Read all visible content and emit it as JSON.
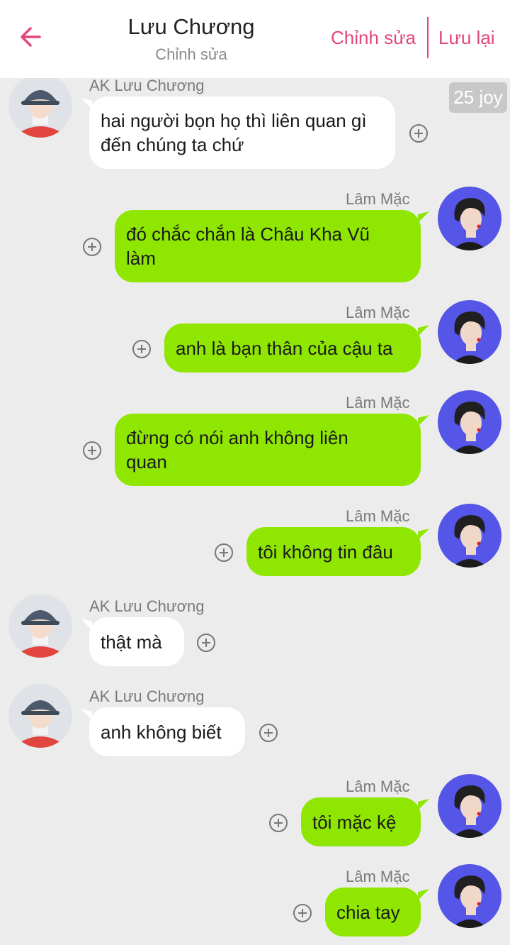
{
  "header": {
    "title": "Lưu Chương",
    "subtitle": "Chỉnh sửa",
    "edit_label": "Chỉnh sửa",
    "save_label": "Lưu lại"
  },
  "badge": "25 joy",
  "colors": {
    "accent": "#e2467f",
    "bubble_out": "#8fe600",
    "bubble_in": "#ffffff",
    "background": "#ececec"
  },
  "icons": {
    "back": "arrow-left-icon",
    "add": "plus-circle-icon"
  },
  "messages": [
    {
      "sender": "AK Lưu Chương",
      "direction": "in",
      "lines": [
        "hai người bọn họ thì liên quan gì",
        "đến chúng ta chứ"
      ]
    },
    {
      "sender": "Lâm Mặc",
      "direction": "out",
      "lines": [
        "đó chắc chắn là Châu Kha Vũ",
        "làm"
      ]
    },
    {
      "sender": "Lâm Mặc",
      "direction": "out",
      "lines": [
        "anh là bạn thân của cậu ta"
      ]
    },
    {
      "sender": "Lâm Mặc",
      "direction": "out",
      "lines": [
        "đừng có nói anh không liên",
        "quan"
      ]
    },
    {
      "sender": "Lâm Mặc",
      "direction": "out",
      "lines": [
        "tôi không tin đâu"
      ]
    },
    {
      "sender": "AK Lưu Chương",
      "direction": "in",
      "lines": [
        "thật mà"
      ]
    },
    {
      "sender": "AK Lưu Chương",
      "direction": "in",
      "lines": [
        "anh không biết"
      ]
    },
    {
      "sender": "Lâm Mặc",
      "direction": "out",
      "lines": [
        "tôi mặc kệ"
      ]
    },
    {
      "sender": "Lâm Mặc",
      "direction": "out",
      "lines": [
        "chia tay"
      ]
    }
  ]
}
